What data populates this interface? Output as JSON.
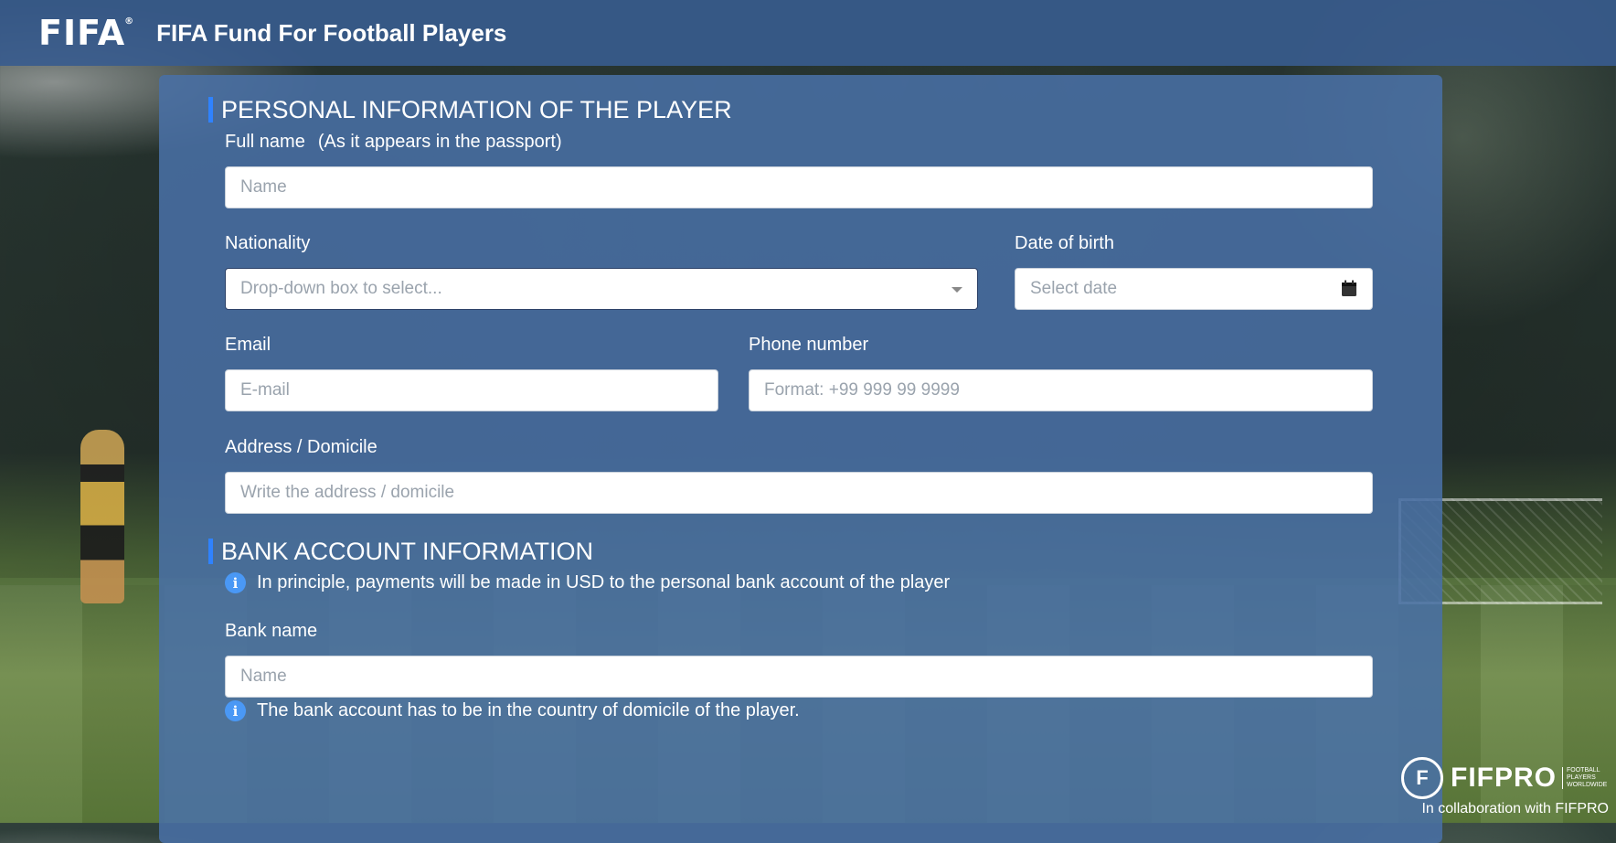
{
  "header": {
    "logo_text": "FIFA",
    "logo_mark": "®",
    "title": "FIFA Fund For Football Players"
  },
  "personal": {
    "heading": "PERSONAL INFORMATION OF THE PLAYER",
    "full_name": {
      "label": "Full name",
      "hint": "(As it appears in the passport)",
      "placeholder": "Name",
      "value": ""
    },
    "nationality": {
      "label": "Nationality",
      "placeholder": "Drop-down box to select...",
      "icon": "chevron-down-icon"
    },
    "date_of_birth": {
      "label": "Date of birth",
      "placeholder": "Select date",
      "icon": "calendar-icon"
    },
    "email": {
      "label": "Email",
      "placeholder": "E-mail",
      "value": ""
    },
    "phone": {
      "label": "Phone number",
      "placeholder": "Format: +99 999 99 9999",
      "value": ""
    },
    "address": {
      "label": "Address / Domicile",
      "placeholder": "Write the address / domicile",
      "value": ""
    }
  },
  "bank": {
    "heading": "BANK ACCOUNT INFORMATION",
    "info_payments": "In principle, payments will be made in USD to the personal bank account of the player",
    "bank_name": {
      "label": "Bank name",
      "placeholder": "Name",
      "value": ""
    },
    "info_country": "The bank account has to be in the country of domicile of the player."
  },
  "footer": {
    "fifpro_word": "FIFPRO",
    "fifpro_sub_1": "FOOTBALL",
    "fifpro_sub_2": "PLAYERS",
    "fifpro_sub_3": "WORLDWIDE",
    "fifpro_mark": "F",
    "collaboration": "In collaboration with FIFPRO"
  },
  "colors": {
    "header_bg": "#375a8c",
    "panel_bg": "#4970a5",
    "accent": "#2f82ff",
    "info_icon": "#4a98f5"
  }
}
